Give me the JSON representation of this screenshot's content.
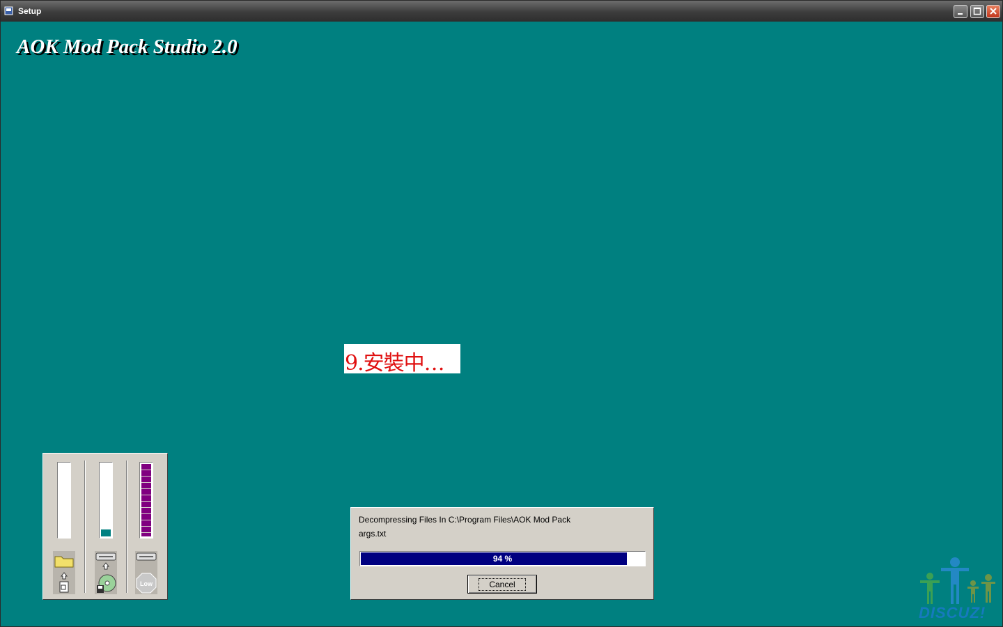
{
  "window": {
    "title": "Setup",
    "icon": "setup-icon",
    "controls": {
      "minimize": "minimize-icon",
      "maximize": "maximize-icon",
      "close": "close-icon"
    }
  },
  "app": {
    "title": "AOK Mod Pack Studio 2.0",
    "status": "9.安裝中…"
  },
  "meters": [
    {
      "name": "destination-disk",
      "level": 0,
      "color": "#008080",
      "icon": "folder-icon"
    },
    {
      "name": "source-disk",
      "level": 0.1,
      "color": "#008080",
      "icon": "cd-disk-icon"
    },
    {
      "name": "memory",
      "level": 1.0,
      "color": "#800080",
      "icon": "low-icon",
      "icon_label": "Low"
    }
  ],
  "dialog": {
    "line1": "Decompressing Files In C:\\Program Files\\AOK Mod Pack",
    "line2": "args.txt",
    "progress": {
      "percent": 94,
      "label": "94 %"
    },
    "cancel_label": "Cancel"
  },
  "watermark": {
    "text": "DISCUZ!"
  },
  "colors": {
    "background": "#008080",
    "progress": "#000080",
    "status_text": "#e01010"
  }
}
